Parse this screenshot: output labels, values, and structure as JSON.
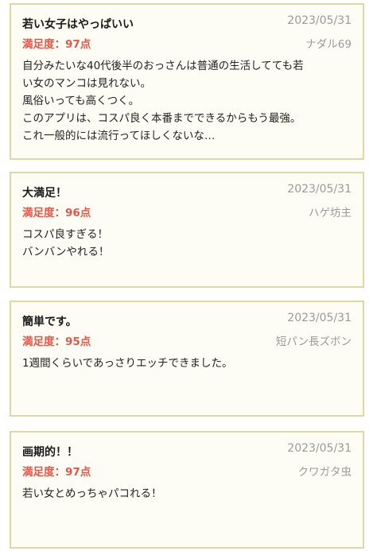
{
  "reviews": [
    {
      "title": "若い女子はやっぱいい",
      "date": "2023/05/31",
      "score": "満足度：97点",
      "author": "ナダル69",
      "lines": [
        "自分みたいな40代後半のおっさんは普通の生活してても若",
        "い女のマンコは見れない。",
        "風俗いっても高くつく。",
        "このアプリは、コスパ良く本番までできるからもう最強。",
        "これ一般的には流行ってほしくないな…"
      ]
    },
    {
      "title": "大満足！",
      "date": "2023/05/31",
      "score": "満足度：96点",
      "author": "ハゲ坊主",
      "lines": [
        "コスパ良すぎる！",
        "バンバンやれる！"
      ]
    },
    {
      "title": "簡単です。",
      "date": "2023/05/31",
      "score": "満足度：95点",
      "author": "短パン長ズボン",
      "lines": [
        "1週間くらいであっさりエッチできました。"
      ]
    },
    {
      "title": "画期的！！",
      "date": "2023/05/31",
      "score": "満足度：97点",
      "author": "クワガタ虫",
      "lines": [
        "若い女とめっちゃパコれる！"
      ]
    }
  ]
}
